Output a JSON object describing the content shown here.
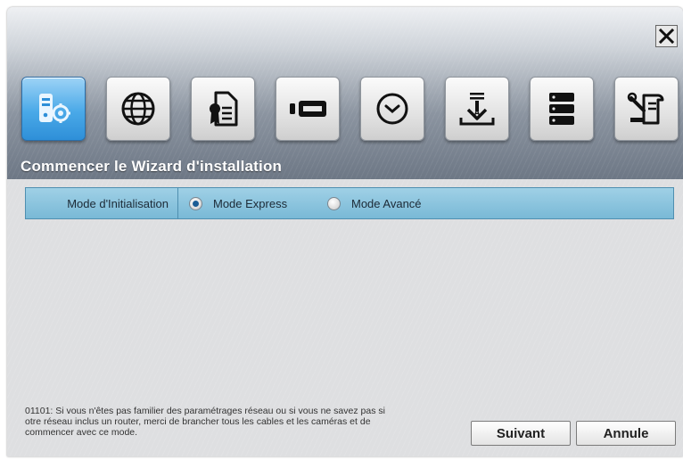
{
  "header": {
    "title": "Commencer le Wizard d'installation",
    "close_label": "Close",
    "steps": [
      {
        "icon": "system-settings-icon",
        "active": true
      },
      {
        "icon": "globe-network-icon",
        "active": false
      },
      {
        "icon": "certificate-document-icon",
        "active": false
      },
      {
        "icon": "video-camera-icon",
        "active": false
      },
      {
        "icon": "clock-icon",
        "active": false
      },
      {
        "icon": "stamp-approval-icon",
        "active": false
      },
      {
        "icon": "server-storage-icon",
        "active": false
      },
      {
        "icon": "tools-document-icon",
        "active": false
      }
    ]
  },
  "mode": {
    "label": "Mode d'Initialisation",
    "options": [
      {
        "label": "Mode Express",
        "checked": true
      },
      {
        "label": "Mode Avancé",
        "checked": false
      }
    ]
  },
  "note": "01101: Si vous n'êtes pas familier des paramétrages réseau ou si vous ne savez pas si otre réseau inclus un router, merci de brancher tous les cables et les caméras et de commencer avec ce mode.",
  "footer": {
    "next_label": "Suivant",
    "cancel_label": "Annule"
  },
  "colors": {
    "active_tile": "#4aa9e8",
    "mode_bar": "#8cc6de",
    "radio_checked": "#1b5d95"
  }
}
